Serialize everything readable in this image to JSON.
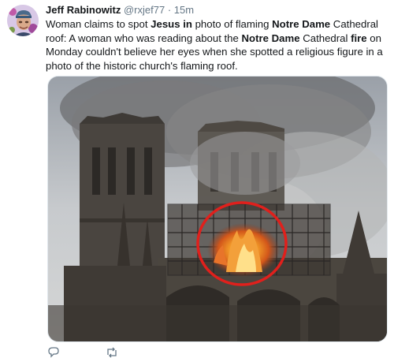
{
  "tweet": {
    "author_name": "Jeff Rabinowitz",
    "author_handle": "@rxjef77",
    "separator": "·",
    "time": "15m",
    "text_segments": [
      {
        "text": "Woman claims to spot ",
        "bold": false
      },
      {
        "text": "Jesus in",
        "bold": true
      },
      {
        "text": " photo of flaming ",
        "bold": false
      },
      {
        "text": "Notre Dame",
        "bold": true
      },
      {
        "text": " Cathedral roof: A woman who was reading about the ",
        "bold": false
      },
      {
        "text": "Notre Dame",
        "bold": true
      },
      {
        "text": " Cathedral ",
        "bold": false
      },
      {
        "text": "fire",
        "bold": true
      },
      {
        "text": " on Monday couldn't believe her eyes when she spotted a religious figure in a photo of the historic church's flaming roof.",
        "bold": false
      }
    ]
  },
  "icons": {
    "avatar": "user-avatar",
    "reply": "reply-icon",
    "retweet": "retweet-icon",
    "like": "heart-icon",
    "share": "share-icon"
  },
  "colors": {
    "name": "#14171a",
    "meta": "#657786",
    "highlight_circle": "#e0201c",
    "fire": "#f08a1c"
  }
}
